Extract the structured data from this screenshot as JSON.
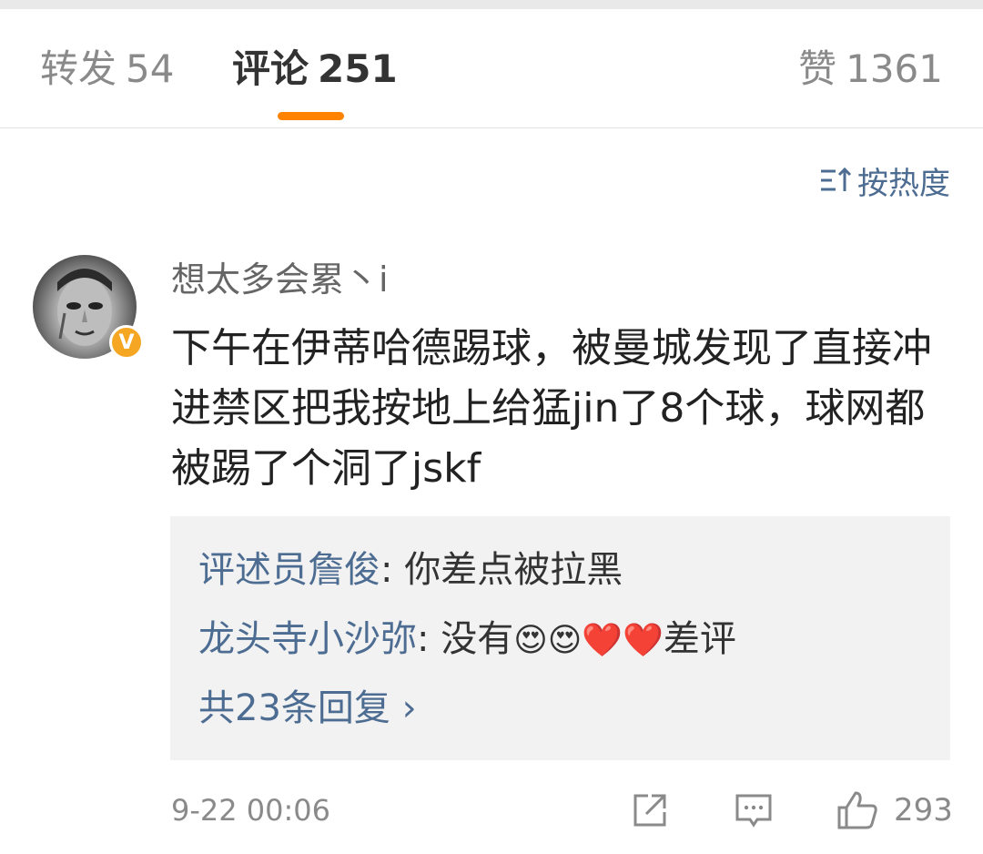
{
  "tabs": {
    "repost": {
      "label": "转发",
      "count": "54"
    },
    "comments": {
      "label": "评论",
      "count": "251"
    },
    "likes": {
      "label": "赞",
      "count": "1361"
    }
  },
  "sort": {
    "label": "按热度"
  },
  "comment": {
    "username": "想太多会累丶i",
    "content": "下午在伊蒂哈德踢球，被曼城发现了直接冲进禁区把我按地上给猛jin了8个球，球网都被踢了个洞了jskf",
    "replies": [
      {
        "author": "评述员詹俊",
        "text": "你差点被拉黑"
      },
      {
        "author": "龙头寺小沙弥",
        "text_before": "没有",
        "emojis": [
          "😍",
          "😍",
          "❤️",
          "❤️"
        ],
        "text_after": "差评"
      }
    ],
    "more_replies": "共23条回复 ›",
    "time": "9-22 00:06",
    "like_count": "293"
  },
  "colors": {
    "accent": "#ff8200",
    "link": "#4d6c92",
    "badge": "#f5a623",
    "reply_bg": "#f2f2f2"
  }
}
